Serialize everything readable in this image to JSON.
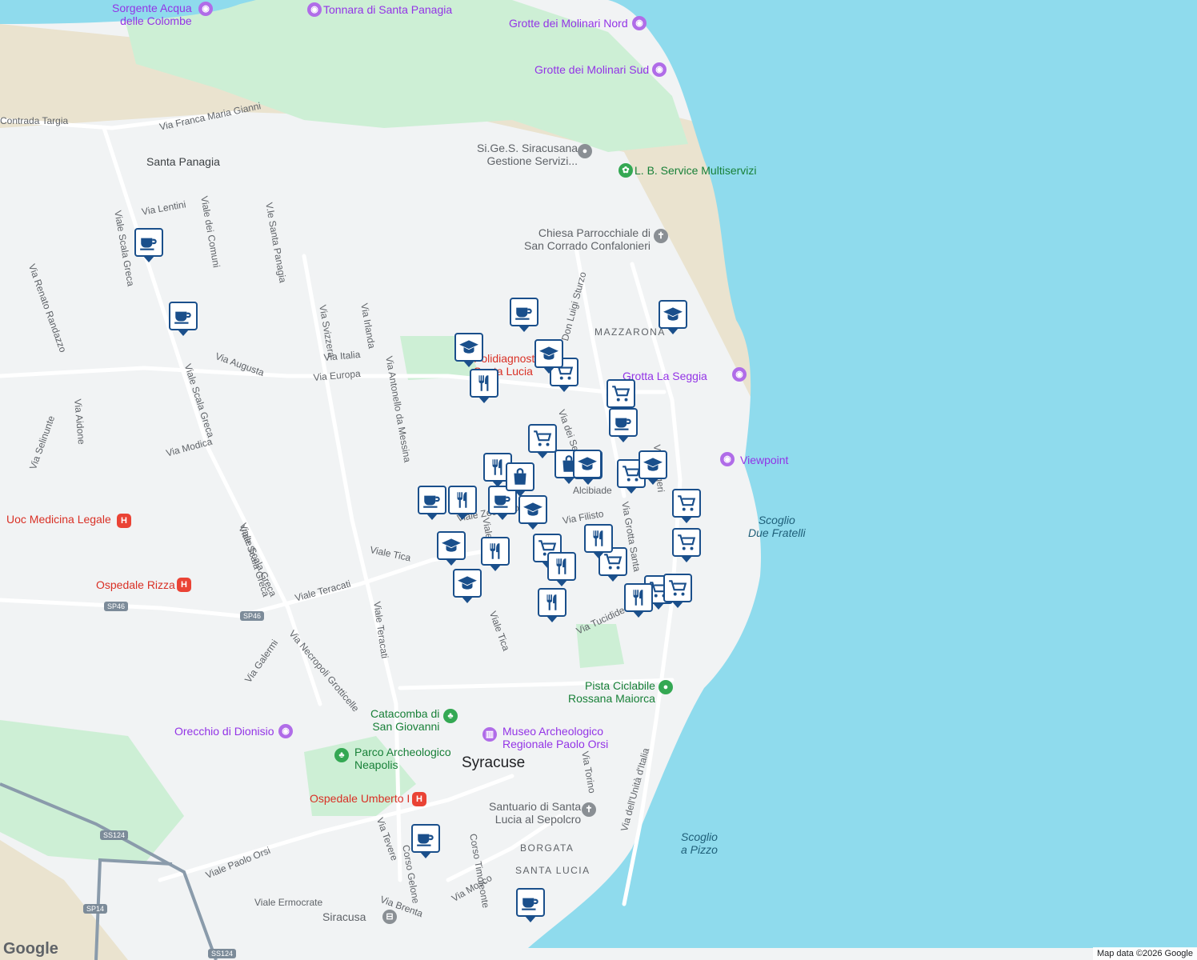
{
  "map": {
    "colors": {
      "sea": "#8fdbed",
      "land": "#f1f3f4",
      "park": "#cdefd5",
      "sand": "#eae3cf",
      "road": "#ffffff",
      "highway": "#8a9bab",
      "marker_border": "#1a4f8b"
    },
    "city": "Syracuse",
    "areas": [
      "Santa Panagia",
      "MAZZARONA",
      "BORGATA SANTA LUCIA"
    ],
    "sea_labels": [
      [
        "Scoglio",
        "Due Fratelli"
      ],
      [
        "Scoglio",
        "a Pizzo"
      ]
    ],
    "roads": [
      "Contrada Targia",
      "Via Franca Maria Gianni",
      "Via Lentini",
      "Viale Scala Greca",
      "Viale dei Comuni",
      "V.le Santa Panagia",
      "Via Renato Randazzo",
      "Via Svizzera",
      "Via Irlanda",
      "Via Italia",
      "Via Europa",
      "Via Augusta",
      "Via Aidone",
      "Via Selinunte",
      "Via Modica",
      "Viale Scala Greca",
      "Viale Scala Greca",
      "Via Antonello da Messina",
      "Viale Tica",
      "Viale Teracati",
      "Viale Teracati",
      "Via Necropoli Grotticelle",
      "Via Galermi",
      "Viale Tica",
      "Via Tucidide",
      "Via Grotta Santa",
      "Viale Algeri",
      "Via dei Sette",
      "Don Luigi Sturzo",
      "Via Torino",
      "Via dell'Unità d'Italia",
      "Viale Paolo Orsi",
      "Via Tevere",
      "Corso Gelone",
      "Corso Timoleonte",
      "Via Mosco",
      "Via Brenta",
      "Viale Ermocrate",
      "Viale Zecchino",
      "Alcibiade",
      "Via Filisto",
      "Viale Scala Greca",
      "Viale Tica"
    ],
    "shields": [
      "SP46",
      "SP46",
      "SS124",
      "SP14",
      "SS124"
    ],
    "pois": [
      {
        "name": "Sorgente Acqua delle Colombe",
        "lines": [
          "Sorgente Acqua",
          "delle Colombe"
        ],
        "category": "purple",
        "icon": "camera-icon"
      },
      {
        "name": "Tonnara di Santa Panagia",
        "lines": [
          "Tonnara di Santa Panagia"
        ],
        "category": "purple",
        "icon": "camera-icon"
      },
      {
        "name": "Grotte dei Molinari Nord",
        "lines": [
          "Grotte dei Molinari Nord"
        ],
        "category": "purple",
        "icon": "camera-icon"
      },
      {
        "name": "Grotte dei Molinari Sud",
        "lines": [
          "Grotte dei Molinari Sud"
        ],
        "category": "purple",
        "icon": "camera-icon"
      },
      {
        "name": "Si.Ge.S. Siracusana Gestione Servizi...",
        "lines": [
          "Si.Ge.S. Siracusana",
          "Gestione Servizi..."
        ],
        "category": "grey",
        "icon": "pin-icon"
      },
      {
        "name": "L. B. Service Multiservizi",
        "lines": [
          "L. B. Service Multiservizi"
        ],
        "category": "green",
        "icon": "flower-icon"
      },
      {
        "name": "Chiesa Parrocchiale di San Corrado Confalonieri",
        "lines": [
          "Chiesa Parrocchiale di",
          "San Corrado Confalonieri"
        ],
        "category": "grey",
        "icon": "cross-icon"
      },
      {
        "name": "Grotta La Seggia",
        "lines": [
          "Grotta La Seggia"
        ],
        "category": "purple",
        "icon": "camera-icon"
      },
      {
        "name": "Viewpoint",
        "lines": [
          "Viewpoint"
        ],
        "category": "purple",
        "icon": "camera-icon"
      },
      {
        "name": "Uoc Medicina Legale",
        "lines": [
          "Uoc Medicina Legale"
        ],
        "category": "red",
        "icon": "hospital-icon"
      },
      {
        "name": "Ospedale Rizza",
        "lines": [
          "Ospedale Rizza"
        ],
        "category": "red",
        "icon": "hospital-icon"
      },
      {
        "name": "Pista Ciclabile Rossana Maiorca",
        "lines": [
          "Pista Ciclabile",
          "Rossana Maiorca"
        ],
        "category": "green",
        "icon": "park-icon"
      },
      {
        "name": "Catacomba di San Giovanni",
        "lines": [
          "Catacomba di",
          "San Giovanni"
        ],
        "category": "green",
        "icon": "tree-icon"
      },
      {
        "name": "Museo Archeologico Regionale Paolo Orsi",
        "lines": [
          "Museo Archeologico",
          "Regionale Paolo Orsi"
        ],
        "category": "purple",
        "icon": "museum-icon"
      },
      {
        "name": "Orecchio di Dionisio",
        "lines": [
          "Orecchio di Dionisio"
        ],
        "category": "purple",
        "icon": "camera-icon"
      },
      {
        "name": "Parco Archeologico Neapolis",
        "lines": [
          "Parco Archeologico",
          "Neapolis"
        ],
        "category": "green",
        "icon": "tree-icon"
      },
      {
        "name": "Ospedale Umberto I",
        "lines": [
          "Ospedale Umberto I"
        ],
        "category": "red",
        "icon": "hospital-icon"
      },
      {
        "name": "Santuario di Santa Lucia al Sepolcro",
        "lines": [
          "Santuario di Santa",
          "Lucia al Sepolcro"
        ],
        "category": "grey",
        "icon": "cross-icon"
      },
      {
        "name": "Siracusa",
        "lines": [
          "Siracusa"
        ],
        "category": "grey",
        "icon": "train-icon"
      },
      {
        "name": "Polidiagnostico Santa Lucia",
        "lines": [
          "Polidiagnostico",
          "Santa Lucia"
        ],
        "category": "red",
        "icon": ""
      }
    ],
    "markers": [
      {
        "type": "cafe"
      },
      {
        "type": "cafe"
      },
      {
        "type": "cafe"
      },
      {
        "type": "school"
      },
      {
        "type": "school"
      },
      {
        "type": "grocery"
      },
      {
        "type": "restaurant"
      },
      {
        "type": "grocery"
      },
      {
        "type": "school"
      },
      {
        "type": "cafe"
      },
      {
        "type": "grocery"
      },
      {
        "type": "restaurant"
      },
      {
        "type": "shopping"
      },
      {
        "type": "school"
      },
      {
        "type": "grocery"
      },
      {
        "type": "school"
      },
      {
        "type": "cafe"
      },
      {
        "type": "restaurant"
      },
      {
        "type": "cafe"
      },
      {
        "type": "school"
      },
      {
        "type": "grocery"
      },
      {
        "type": "grocery"
      },
      {
        "type": "school"
      },
      {
        "type": "restaurant"
      },
      {
        "type": "grocery"
      },
      {
        "type": "restaurant"
      },
      {
        "type": "restaurant"
      },
      {
        "type": "grocery"
      },
      {
        "type": "grocery"
      },
      {
        "type": "grocery"
      },
      {
        "type": "restaurant"
      },
      {
        "type": "school"
      },
      {
        "type": "restaurant"
      },
      {
        "type": "cafe"
      },
      {
        "type": "cafe"
      },
      {
        "type": "shopping"
      },
      {
        "type": "school"
      }
    ]
  },
  "footer": {
    "logo": "Google",
    "attribution": "Map data ©2026 Google"
  }
}
